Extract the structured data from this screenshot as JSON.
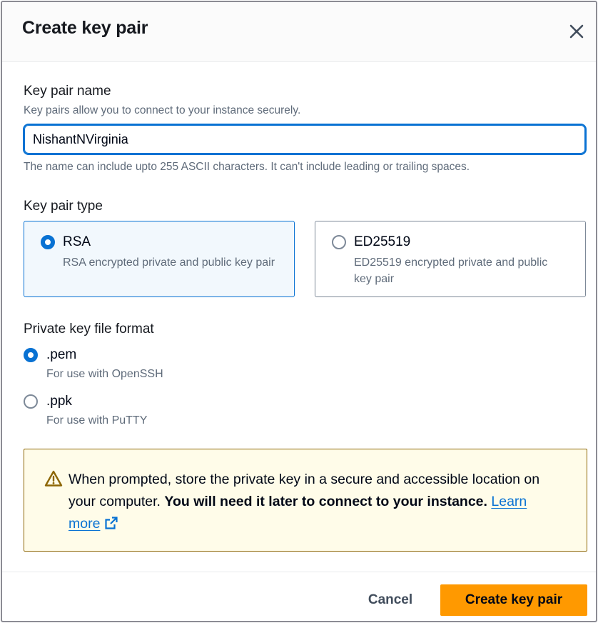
{
  "dialog": {
    "title": "Create key pair",
    "close_icon": "close-icon"
  },
  "key_pair_name": {
    "label": "Key pair name",
    "description": "Key pairs allow you to connect to your instance securely.",
    "value": "NishantNVirginia",
    "constraint": "The name can include upto 255 ASCII characters. It can't include leading or trailing spaces."
  },
  "key_pair_type": {
    "label": "Key pair type",
    "options": [
      {
        "title": "RSA",
        "description": "RSA encrypted private and public key pair",
        "selected": true
      },
      {
        "title": "ED25519",
        "description": "ED25519 encrypted private and public key pair",
        "selected": false
      }
    ]
  },
  "file_format": {
    "label": "Private key file format",
    "options": [
      {
        "title": ".pem",
        "description": "For use with OpenSSH",
        "selected": true
      },
      {
        "title": ".ppk",
        "description": "For use with PuTTY",
        "selected": false
      }
    ]
  },
  "alert": {
    "icon": "warning-icon",
    "text": "When prompted, store the private key in a secure and accessible location on your computer.",
    "bold_text": "You will need it later to connect to your instance.",
    "link_text": "Learn more",
    "link_icon": "external-link-icon"
  },
  "footer": {
    "cancel_label": "Cancel",
    "create_label": "Create key pair"
  },
  "colors": {
    "primary_button": "#ff9900",
    "accent": "#0972d3",
    "warning_border": "#8d6605",
    "warning_bg": "#fffce9"
  }
}
